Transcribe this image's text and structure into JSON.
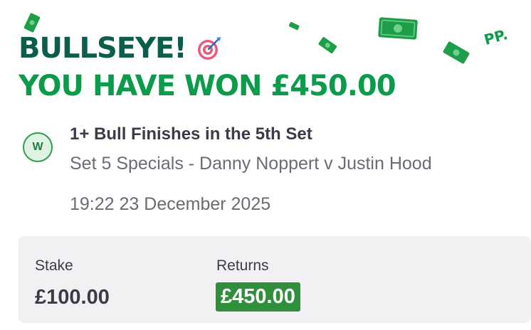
{
  "header": {
    "line1": "BULLSEYE!",
    "line2": "YOU HAVE WON £450.00",
    "target_icon": "dartboard-target-icon",
    "brand_mark": "PP."
  },
  "bet": {
    "result_badge": "W",
    "selection": "1+ Bull Finishes in the 5th Set",
    "market": "Set 5 Specials - Danny Noppert v Justin Hood",
    "datetime": "19:22 23 December 2025"
  },
  "summary": {
    "stake_label": "Stake",
    "stake_value": "£100.00",
    "returns_label": "Returns",
    "returns_value": "£450.00"
  },
  "colors": {
    "headline_dark": "#0b5d4c",
    "headline_green": "#0a9b4b",
    "returns_green": "#2f8f3b",
    "badge_border": "#2f9e4f"
  }
}
